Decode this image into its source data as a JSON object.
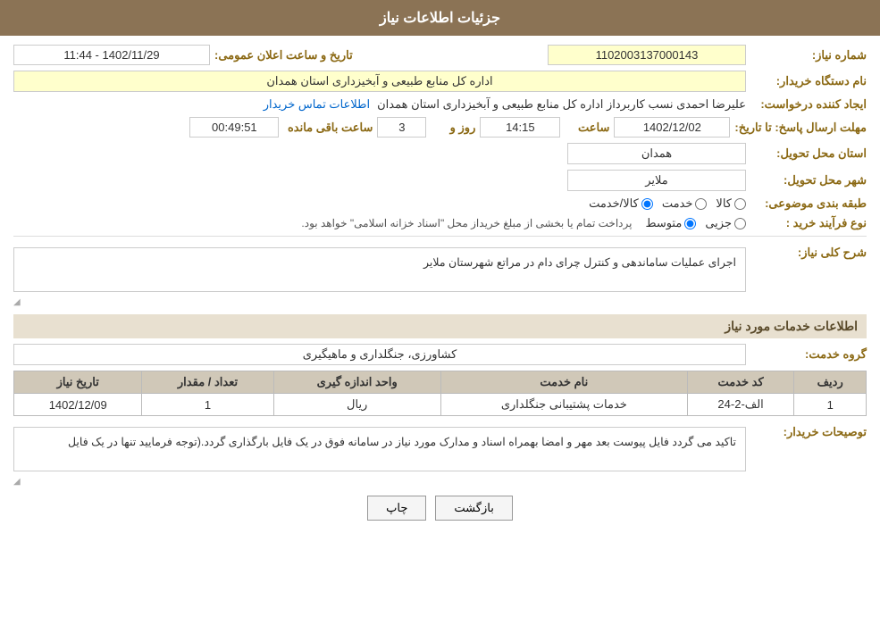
{
  "header": {
    "title": "جزئیات اطلاعات نیاز"
  },
  "fields": {
    "shomareNiaz_label": "شماره نیاز:",
    "shomareNiaz_value": "1102003137000143",
    "namDastgah_label": "نام دستگاه خریدار:",
    "namDastgah_value": "اداره کل منابع طبیعی و آبخیزداری استان همدان",
    "tarikh_label": "تاریخ و ساعت اعلان عمومی:",
    "tarikh_value": "1402/11/29 - 11:44",
    "ijadKonande_label": "ایجاد کننده درخواست:",
    "ijadKonande_value": "علیرضا احمدی نسب کاربرداز اداره کل منابع طبیعی و آبخیزداری استان همدان",
    "contactInfo_label": "اطلاعات تماس خریدار",
    "mohlatIrsalPasakh_label": "مهلت ارسال پاسخ: تا تاریخ:",
    "date_value": "1402/12/02",
    "saat_label": "ساعت",
    "saat_value": "14:15",
    "rooz_label": "روز و",
    "rooz_value": "3",
    "baghiMandeSaat_label": "ساعت باقی مانده",
    "baghiMandeSaat_value": "00:49:51",
    "ostanTahvil_label": "استان محل تحویل:",
    "ostanTahvil_value": "همدان",
    "shahrTahvil_label": "شهر محل تحویل:",
    "shahrTahvil_value": "ملایر",
    "tabaqeBandiMozooi_label": "طبقه بندی موضوعی:",
    "radio_kala": "کالا",
    "radio_khedmat": "خدمت",
    "radio_kalaKhedmat": "کالا/خدمت",
    "noeFarayandKharid_label": "نوع فرآیند خرید :",
    "radio_jozei": "جزیی",
    "radio_mottasset": "متوسط",
    "process_note": "پرداخت تمام یا بخشی از مبلغ خریداز محل \"اسناد خزانه اسلامی\" خواهد بود.",
    "sharhKolliNiaz_label": "شرح کلی نیاز:",
    "sharhKolliNiaz_value": "اجرای عملیات ساماندهی و کنترل چرای دام در مراتع شهرستان ملایر",
    "section_khadamat": "اطلاعات خدمات مورد نیاز",
    "goroheKhedmat_label": "گروه خدمت:",
    "goroheKhedmat_value": "کشاورزی، جنگلداری و ماهیگیری",
    "table": {
      "headers": [
        "ردیف",
        "کد خدمت",
        "نام خدمت",
        "واحد اندازه گیری",
        "تعداد / مقدار",
        "تاریخ نیاز"
      ],
      "rows": [
        {
          "radif": "1",
          "kodKhedmat": "الف-2-24",
          "namKhedmat": "خدمات پشتیبانی جنگلداری",
          "vahedAndaze": "ریال",
          "tedad": "1",
          "tarikh": "1402/12/09"
        }
      ]
    },
    "tosihKhardar_label": "توصیحات خریدار:",
    "tosihKhardar_value": "تاکید می گردد فایل پیوست بعد مهر و امضا بهمراه اسناد و مدارک مورد نیاز در سامانه فوق در یک فایل بارگذاری گردد.(توجه فرمایید تنها در یک فایل",
    "btn_chap": "چاپ",
    "btn_bazgasht": "بازگشت"
  }
}
